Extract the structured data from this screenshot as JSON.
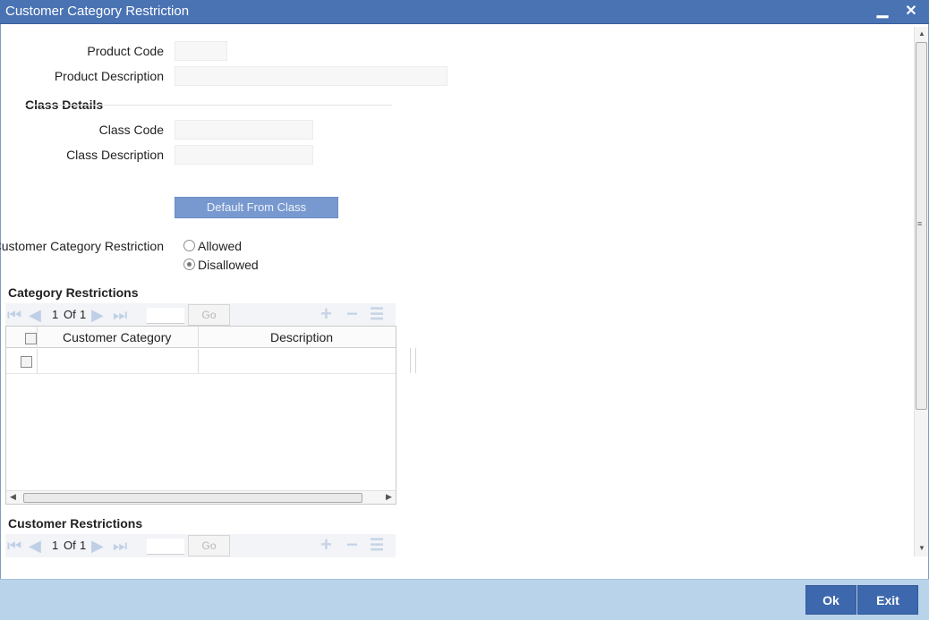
{
  "window": {
    "title": "Customer Category Restriction",
    "minimize_glyph": "▁",
    "close_glyph": "✕"
  },
  "product": {
    "code_label": "Product Code",
    "code_value": "",
    "description_label": "Product Description",
    "description_value": ""
  },
  "class_details": {
    "section_title": "Class Details",
    "code_label": "Class Code",
    "code_value": "",
    "description_label": "Class Description",
    "description_value": ""
  },
  "default_button_label": "Default From Class",
  "restriction": {
    "label": "Customer Category Restriction",
    "options": [
      {
        "label": "Allowed",
        "checked": false
      },
      {
        "label": "Disallowed",
        "checked": true
      }
    ]
  },
  "category_restrictions": {
    "section_title": "Category Restrictions",
    "pager": {
      "current": "1",
      "of_label": "Of",
      "total": "1",
      "go_label": "Go"
    },
    "columns": [
      "Customer Category",
      "Description"
    ],
    "rows": [
      {
        "customer_category": "",
        "description": ""
      }
    ]
  },
  "customer_restrictions": {
    "section_title": "Customer Restrictions",
    "pager": {
      "current": "1",
      "of_label": "Of",
      "total": "1",
      "go_label": "Go"
    }
  },
  "footer": {
    "ok_label": "Ok",
    "exit_label": "Exit"
  },
  "colors": {
    "titlebar": "#4a73b4",
    "footer": "#b9d3ea",
    "footer_button": "#3e68ad",
    "default_button": "#7899cf"
  }
}
